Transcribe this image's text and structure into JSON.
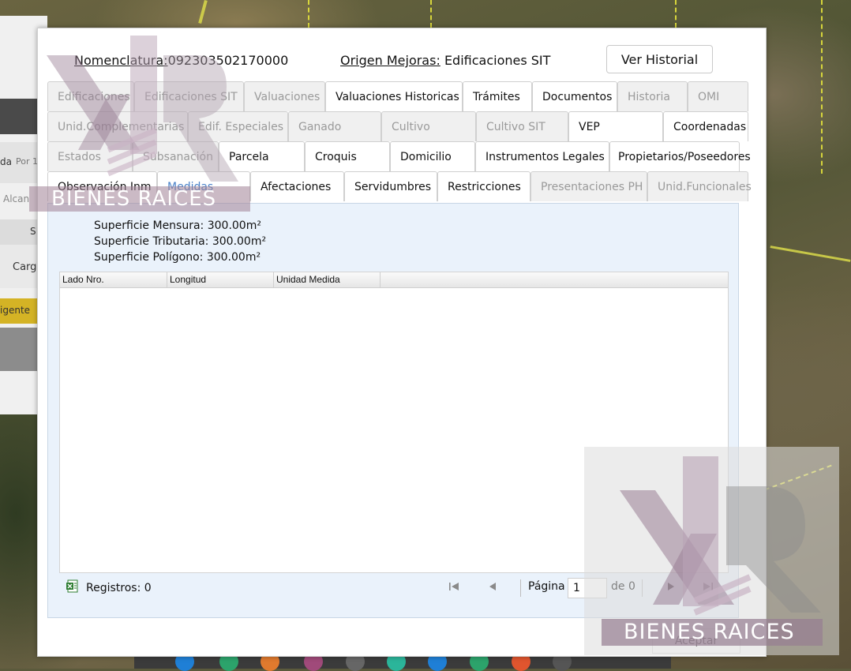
{
  "dialog": {
    "nomenclatura_label": "Nomenclatura:",
    "nomenclatura_value": "092303502170000",
    "origen_label": "Origen Mejoras:",
    "origen_value": "Edificaciones SIT",
    "history_button": "Ver Historial"
  },
  "tabs": {
    "row1": [
      {
        "label": "Edificaciones",
        "state": "disabled"
      },
      {
        "label": "Edificaciones SIT",
        "state": "disabled"
      },
      {
        "label": "Valuaciones",
        "state": "disabled"
      },
      {
        "label": "Valuaciones Historicas",
        "state": "normal"
      },
      {
        "label": "Trámites",
        "state": "normal"
      },
      {
        "label": "Documentos",
        "state": "normal"
      },
      {
        "label": "Historia",
        "state": "disabled"
      },
      {
        "label": "OMI",
        "state": "disabled"
      }
    ],
    "row2": [
      {
        "label": "Unid.Complementarias",
        "state": "disabled"
      },
      {
        "label": "Edif. Especiales",
        "state": "disabled"
      },
      {
        "label": "Ganado",
        "state": "disabled"
      },
      {
        "label": "Cultivo",
        "state": "disabled"
      },
      {
        "label": "Cultivo SIT",
        "state": "disabled"
      },
      {
        "label": "VEP",
        "state": "normal"
      },
      {
        "label": "Coordenadas",
        "state": "normal"
      }
    ],
    "row3": [
      {
        "label": "Estados",
        "state": "disabled"
      },
      {
        "label": "Subsanación",
        "state": "disabled"
      },
      {
        "label": "Parcela",
        "state": "normal"
      },
      {
        "label": "Croquis",
        "state": "normal"
      },
      {
        "label": "Domicilio",
        "state": "normal"
      },
      {
        "label": "Instrumentos Legales",
        "state": "normal"
      },
      {
        "label": "Propietarios/Poseedores",
        "state": "normal"
      }
    ],
    "row4": [
      {
        "label": "Observación Inm",
        "state": "normal"
      },
      {
        "label": "Medidas",
        "state": "active"
      },
      {
        "label": "Afectaciones",
        "state": "normal"
      },
      {
        "label": "Servidumbres",
        "state": "normal"
      },
      {
        "label": "Restricciones",
        "state": "normal"
      },
      {
        "label": "Presentaciones PH",
        "state": "disabled"
      },
      {
        "label": "Unid.Funcionales",
        "state": "disabled"
      }
    ]
  },
  "medidas": {
    "superficie_mensura": "Superficie Mensura: 300.00m²",
    "superficie_tributaria": "Superficie Tributaria: 300.00m²",
    "superficie_poligono": "Superficie Polígono: 300.00m²",
    "columns": [
      "Lado Nro.",
      "Longitud",
      "Unidad Medida"
    ],
    "rows": []
  },
  "pager": {
    "registros": "Registros: 0",
    "pagina_label": "Página",
    "page_value": "1",
    "de_label": "de 0",
    "first_icon": "first-page-icon",
    "prev_icon": "prev-page-icon",
    "next_icon": "next-page-icon",
    "last_icon": "last-page-icon"
  },
  "accept_button": "Aceptar",
  "background": {
    "panel_texts": [
      "da",
      "Por 1",
      "Alcan",
      "S",
      "Carg",
      "igente"
    ]
  },
  "watermark": {
    "text": "BIENES RAICES"
  },
  "colors": {
    "active_tab": "#4a82c8",
    "content_bg": "#eaf2fb",
    "disabled_tab_bg": "#f0f0f0",
    "vigente_bg": "#d4b325"
  }
}
